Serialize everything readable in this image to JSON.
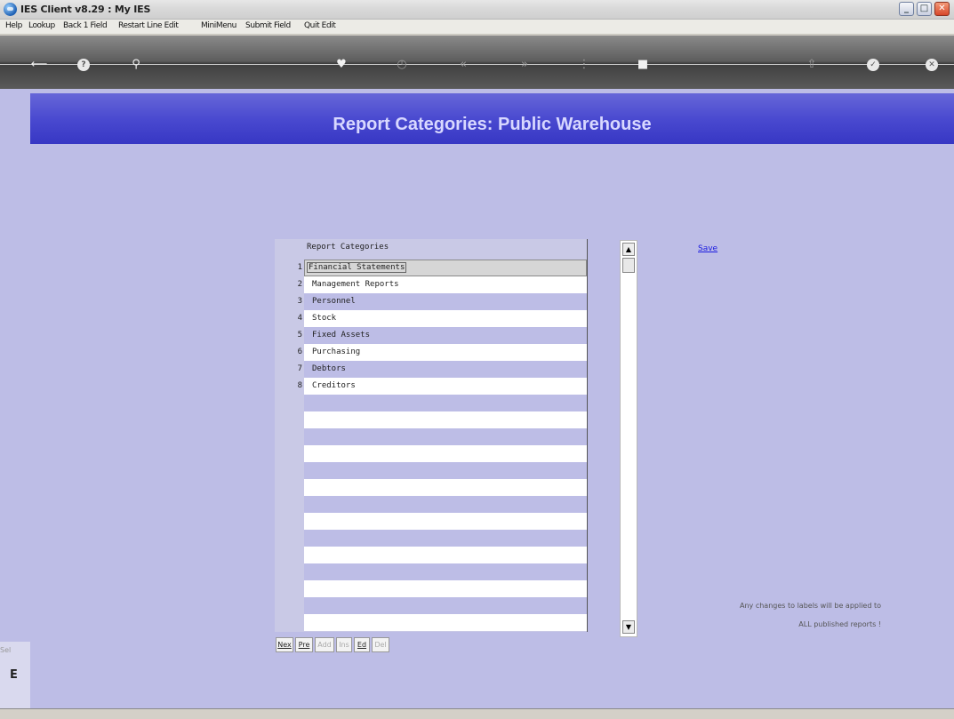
{
  "window": {
    "title": "IES Client v8.29 : My IES"
  },
  "menu": [
    "Help",
    "Lookup",
    "Back 1 Field",
    "Restart Line Edit",
    "MiniMenu",
    "Submit Field",
    "Quit Edit"
  ],
  "toolbar": {
    "icons": [
      "back-key-icon",
      "help-icon",
      "search-icon",
      "heart-icon",
      "clock-icon",
      "rewind-icon",
      "forward-icon",
      "mid-icon",
      "square-icon",
      "up-icon",
      "check-icon",
      "close-icon"
    ]
  },
  "header": {
    "title": "Report Categories: Public Warehouse"
  },
  "grid": {
    "column_header": "Report Categories",
    "rows": [
      {
        "num": "1",
        "label": "Financial Statements"
      },
      {
        "num": "2",
        "label": "Management Reports"
      },
      {
        "num": "3",
        "label": "Personnel"
      },
      {
        "num": "4",
        "label": "Stock"
      },
      {
        "num": "5",
        "label": "Fixed Assets"
      },
      {
        "num": "6",
        "label": "Purchasing"
      },
      {
        "num": "7",
        "label": "Debtors"
      },
      {
        "num": "8",
        "label": "Creditors"
      }
    ]
  },
  "save_label": "Save",
  "note": {
    "line1": "Any changes to labels will be applied to",
    "line2": "ALL published reports !"
  },
  "nav_buttons": [
    "Nex",
    "Pre",
    "Add",
    "Ins",
    "Ed",
    "Del"
  ],
  "left_strip": {
    "label": "Sel",
    "char": "E"
  }
}
